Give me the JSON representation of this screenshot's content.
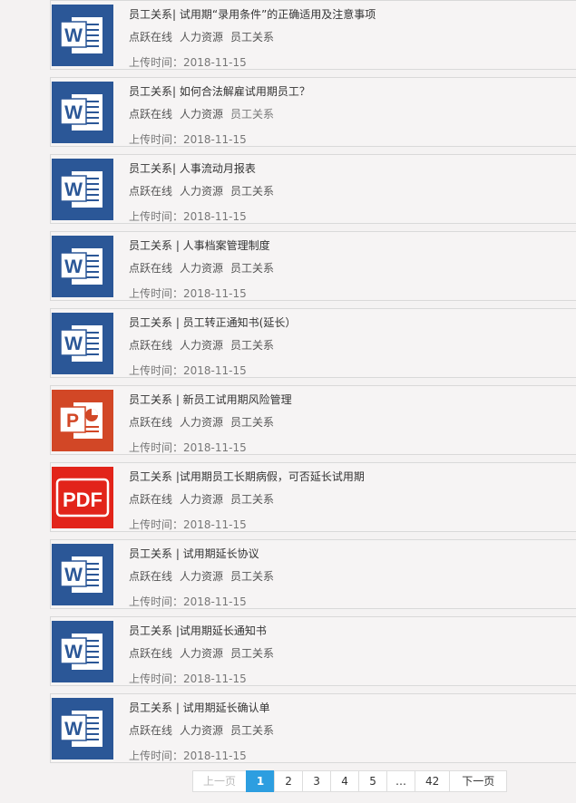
{
  "documents": [
    {
      "title": "员工关系| 试用期“录用条件”的正确适用及注意事项",
      "tags": [
        "点跃在线",
        "人力资源",
        "员工关系"
      ],
      "time": "上传时间：2018-11-15",
      "icon": "word-icon"
    },
    {
      "title": "员工关系| 如何合法解雇试用期员工？",
      "tags": [
        "点跃在线",
        "人力资源",
        "员工关系"
      ],
      "time": "上传时间：2018-11-15",
      "icon": "word-icon"
    },
    {
      "title": "员工关系| 人事流动月报表",
      "tags": [
        "点跃在线",
        "人力资源",
        "员工关系"
      ],
      "time": "上传时间：2018-11-15",
      "icon": "word-icon"
    },
    {
      "title": "员工关系 | 人事档案管理制度",
      "tags": [
        "点跃在线",
        "人力资源",
        "员工关系"
      ],
      "time": "上传时间：2018-11-15",
      "icon": "word-icon"
    },
    {
      "title": "员工关系 | 员工转正通知书(延长）",
      "tags": [
        "点跃在线",
        "人力资源",
        "员工关系"
      ],
      "time": "上传时间：2018-11-15",
      "icon": "word-icon"
    },
    {
      "title": "员工关系 | 新员工试用期风险管理",
      "tags": [
        "点跃在线",
        "人力资源",
        "员工关系"
      ],
      "time": "上传时间：2018-11-15",
      "icon": "powerpoint-icon"
    },
    {
      "title": "员工关系 |试用期员工长期病假，可否延长试用期",
      "tags": [
        "点跃在线",
        "人力资源",
        "员工关系"
      ],
      "time": "上传时间：2018-11-15",
      "icon": "pdf-icon"
    },
    {
      "title": "员工关系 | 试用期延长协议",
      "tags": [
        "点跃在线",
        "人力资源",
        "员工关系"
      ],
      "time": "上传时间：2018-11-15",
      "icon": "word-icon"
    },
    {
      "title": "员工关系 |试用期延长通知书",
      "tags": [
        "点跃在线",
        "人力资源",
        "员工关系"
      ],
      "time": "上传时间：2018-11-15",
      "icon": "word-icon"
    },
    {
      "title": "员工关系 | 试用期延长确认单",
      "tags": [
        "点跃在线",
        "人力资源",
        "员工关系"
      ],
      "time": "上传时间：2018-11-15",
      "icon": "word-icon"
    }
  ],
  "icon_labels": {
    "word": "W",
    "powerpoint": "P",
    "pdf": "PDF"
  },
  "pagination": {
    "prev": "上一页",
    "pages": [
      "1",
      "2",
      "3",
      "4",
      "5",
      "…",
      "42"
    ],
    "active": "1",
    "next": "下一页"
  },
  "colors": {
    "word": "#2b5797",
    "powerpoint": "#d24726",
    "pdf": "#e2241a",
    "active_page": "#2d9ee0"
  }
}
